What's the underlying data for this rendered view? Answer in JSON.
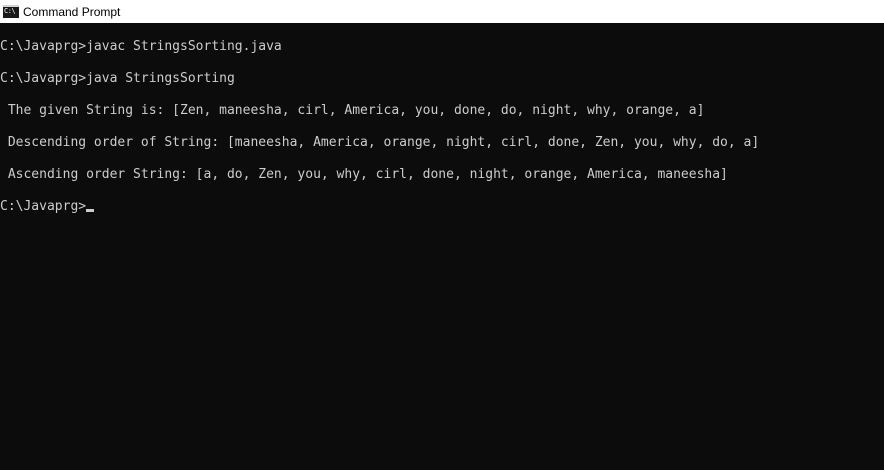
{
  "window": {
    "title": "Command Prompt",
    "icon": "cmd-icon",
    "icon_text": "C:\\"
  },
  "console": {
    "lines": [
      "C:\\Javaprg>javac StringsSorting.java",
      "C:\\Javaprg>java StringsSorting",
      " The given String is: [Zen, maneesha, cirl, America, you, done, do, night, why, orange, a]",
      " Descending order of String: [maneesha, America, orange, night, cirl, done, Zen, you, why, do, a]",
      " Ascending order String: [a, do, Zen, you, why, cirl, done, night, orange, America, maneesha]"
    ],
    "prompt": "C:\\Javaprg>"
  }
}
